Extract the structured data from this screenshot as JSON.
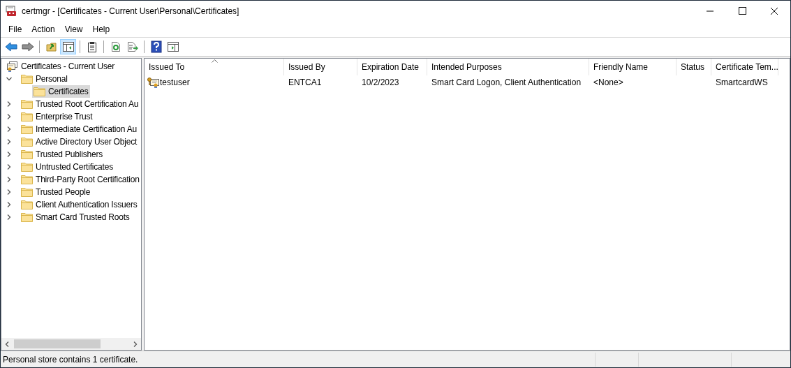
{
  "window": {
    "title": "certmgr - [Certificates - Current User\\Personal\\Certificates]"
  },
  "menu": [
    "File",
    "Action",
    "View",
    "Help"
  ],
  "toolbar": [
    {
      "kind": "back",
      "pressed": false
    },
    {
      "kind": "forward",
      "pressed": false
    },
    {
      "kind": "sep"
    },
    {
      "kind": "up",
      "pressed": false
    },
    {
      "kind": "tree",
      "pressed": true
    },
    {
      "kind": "sep"
    },
    {
      "kind": "properties",
      "pressed": false
    },
    {
      "kind": "sep"
    },
    {
      "kind": "refresh",
      "pressed": false
    },
    {
      "kind": "export",
      "pressed": false
    },
    {
      "kind": "sep"
    },
    {
      "kind": "help",
      "pressed": false
    },
    {
      "kind": "pane",
      "pressed": false
    }
  ],
  "tree": {
    "label": "Certificates - Current User",
    "selected": false,
    "children": [
      {
        "label": "Personal",
        "expanded": true,
        "selected": false,
        "children": [
          {
            "label": "Certificates",
            "selected": true
          }
        ]
      },
      {
        "label": "Trusted Root Certification Au",
        "expanded": false,
        "selected": false
      },
      {
        "label": "Enterprise Trust",
        "expanded": false,
        "selected": false
      },
      {
        "label": "Intermediate Certification Au",
        "expanded": false,
        "selected": false
      },
      {
        "label": "Active Directory User Object",
        "expanded": false,
        "selected": false
      },
      {
        "label": "Trusted Publishers",
        "expanded": false,
        "selected": false
      },
      {
        "label": "Untrusted Certificates",
        "expanded": false,
        "selected": false
      },
      {
        "label": "Third-Party Root Certification",
        "expanded": false,
        "selected": false
      },
      {
        "label": "Trusted People",
        "expanded": false,
        "selected": false
      },
      {
        "label": "Client Authentication Issuers",
        "expanded": false,
        "selected": false
      },
      {
        "label": "Smart Card Trusted Roots",
        "expanded": false,
        "selected": false
      }
    ]
  },
  "table": {
    "columns": [
      {
        "label": "Issued To",
        "sorted": true
      },
      {
        "label": "Issued By",
        "sorted": false
      },
      {
        "label": "Expiration Date",
        "sorted": false
      },
      {
        "label": "Intended Purposes",
        "sorted": false
      },
      {
        "label": "Friendly Name",
        "sorted": false
      },
      {
        "label": "Status",
        "sorted": false
      },
      {
        "label": "Certificate Tem...",
        "sorted": false
      }
    ],
    "rows": [
      {
        "cells": [
          "testuser",
          "ENTCA1",
          "10/2/2023",
          "Smart Card Logon, Client Authentication",
          "<None>",
          "",
          "SmartcardWS"
        ],
        "selected": false
      }
    ]
  },
  "status_bar": "Personal store contains 1 certificate."
}
